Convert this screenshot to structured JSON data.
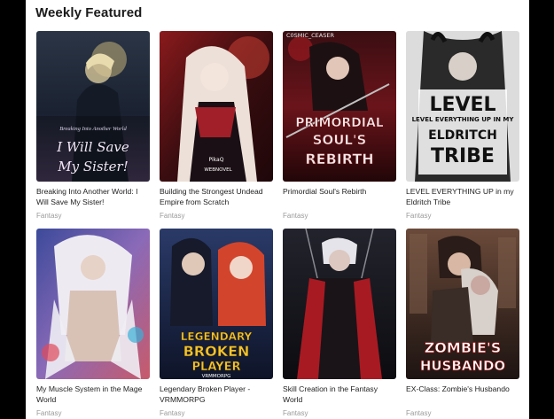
{
  "section": {
    "title": "Weekly Featured"
  },
  "books": [
    {
      "title": "Breaking Into Another World: I Will Save My Sister!",
      "genre": "Fantasy",
      "cover_text_top": "Breaking Into Another World",
      "cover_text_main": "I Will Save My Sister!",
      "palette": [
        "#1d2634",
        "#3b4a5e",
        "#8a6f9c"
      ]
    },
    {
      "title": "Building the Strongest Undead Empire from Scratch",
      "genre": "Fantasy",
      "cover_text_top": "PikaQ",
      "cover_text_main": "WEBNOVEL",
      "palette": [
        "#5a1418",
        "#b32a2a",
        "#e8d6cc"
      ]
    },
    {
      "title": "Primordial Soul's Rebirth",
      "genre": "Fantasy",
      "cover_text_top": "C0SMIC_CEASER",
      "cover_text_main": "PRIMORDIAL SOUL'S REBIRTH",
      "palette": [
        "#2a0e10",
        "#c0262a",
        "#e9e3e3"
      ]
    },
    {
      "title": "LEVEL EVERYTHING UP in my Eldritch Tribe",
      "genre": "Fantasy",
      "cover_text_top": "LEVEL EVERYTHING UP IN MY",
      "cover_text_main": "ELDRITCH TRIBE",
      "palette": [
        "#e6e6e6",
        "#1b1b1b",
        "#6b6b6b"
      ]
    },
    {
      "title": "My Muscle System in the Mage World",
      "genre": "Fantasy",
      "cover_text_top": "",
      "cover_text_main": "",
      "palette": [
        "#4a5aa8",
        "#d7d0e8",
        "#e05a6a"
      ]
    },
    {
      "title": "Legendary Broken Player - VRMMORPG",
      "genre": "Fantasy",
      "cover_text_top": "LEGENDARY BROKEN PLAYER",
      "cover_text_main": "VRMMORPG",
      "palette": [
        "#1a2340",
        "#d4452c",
        "#f2c230"
      ]
    },
    {
      "title": "Skill Creation in the Fantasy World",
      "genre": "Fantasy",
      "cover_text_top": "",
      "cover_text_main": "",
      "palette": [
        "#15161c",
        "#3a2a30",
        "#b21c24"
      ]
    },
    {
      "title": "EX-Class: Zombie's Husbando",
      "genre": "Fantasy",
      "cover_text_top": "ZOMBIE'S",
      "cover_text_main": "HUSBANDO",
      "palette": [
        "#5c3a2e",
        "#c9a48a",
        "#2a1f1c"
      ]
    }
  ]
}
